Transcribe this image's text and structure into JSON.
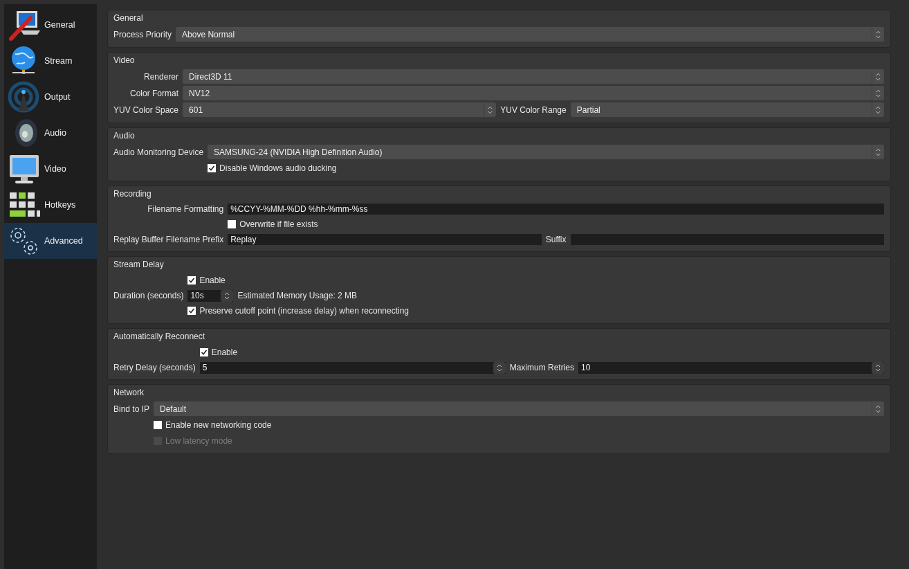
{
  "sidebar": {
    "items": [
      {
        "label": "General",
        "selected": false
      },
      {
        "label": "Stream",
        "selected": false
      },
      {
        "label": "Output",
        "selected": false
      },
      {
        "label": "Audio",
        "selected": false
      },
      {
        "label": "Video",
        "selected": false
      },
      {
        "label": "Hotkeys",
        "selected": false
      },
      {
        "label": "Advanced",
        "selected": true
      }
    ]
  },
  "sections": [
    {
      "title": "General",
      "rows": [
        {
          "label": "Process Priority",
          "controls": [
            {
              "kind": "select",
              "value": "Above Normal"
            }
          ]
        }
      ]
    },
    {
      "title": "Video",
      "rows": [
        {
          "label": "Renderer",
          "controls": [
            {
              "kind": "select",
              "value": "Direct3D 11"
            }
          ]
        },
        {
          "label": "Color Format",
          "controls": [
            {
              "kind": "select",
              "value": "NV12"
            }
          ]
        },
        {
          "label": "YUV Color Space",
          "controls": [
            {
              "kind": "select",
              "value": "601"
            },
            {
              "kind": "label",
              "text": "YUV Color Range"
            },
            {
              "kind": "select",
              "value": "Partial"
            }
          ]
        }
      ]
    },
    {
      "title": "Audio",
      "rows": [
        {
          "label": "Audio Monitoring Device",
          "controls": [
            {
              "kind": "select",
              "value": "SAMSUNG-24 (NVIDIA High Definition Audio)"
            }
          ]
        },
        {
          "controls": [
            {
              "kind": "checkbox",
              "text": "Disable Windows audio ducking",
              "checked": true,
              "disabled": false
            }
          ]
        }
      ]
    },
    {
      "title": "Recording",
      "rows": [
        {
          "label": "Filename Formatting",
          "controls": [
            {
              "kind": "text",
              "value": "%CCYY-%MM-%DD %hh-%mm-%ss"
            }
          ]
        },
        {
          "controls": [
            {
              "kind": "checkbox",
              "text": "Overwrite if file exists",
              "checked": false,
              "disabled": false
            }
          ]
        },
        {
          "label": "Replay Buffer Filename Prefix",
          "controls": [
            {
              "kind": "text",
              "value": "Replay"
            },
            {
              "kind": "label",
              "text": "Suffix"
            },
            {
              "kind": "text"
            }
          ]
        }
      ]
    },
    {
      "title": "Stream Delay",
      "rows": [
        {
          "controls": [
            {
              "kind": "checkbox",
              "text": "Enable",
              "checked": true,
              "disabled": false
            }
          ]
        },
        {
          "label": "Duration (seconds)",
          "controls": [
            {
              "kind": "spin",
              "value": "10s"
            },
            {
              "kind": "note",
              "text": "Estimated Memory Usage: 2 MB"
            }
          ]
        },
        {
          "controls": [
            {
              "kind": "checkbox",
              "text": "Preserve cutoff point (increase delay) when reconnecting",
              "checked": true,
              "disabled": false
            }
          ]
        }
      ]
    },
    {
      "title": "Automatically Reconnect",
      "rows": [
        {
          "controls": [
            {
              "kind": "checkbox",
              "text": "Enable",
              "checked": true,
              "disabled": false
            }
          ]
        },
        {
          "label": "Retry Delay (seconds)",
          "controls": [
            {
              "kind": "spin",
              "value": "5"
            },
            {
              "kind": "label",
              "text": "Maximum Retries"
            },
            {
              "kind": "spin",
              "value": "10"
            }
          ]
        }
      ]
    },
    {
      "title": "Network",
      "rows": [
        {
          "label": "Bind to IP",
          "controls": [
            {
              "kind": "select",
              "value": "Default"
            }
          ]
        },
        {
          "controls": [
            {
              "kind": "checkbox",
              "text": "Enable new networking code",
              "checked": false,
              "disabled": false
            }
          ]
        },
        {
          "controls": [
            {
              "kind": "checkbox",
              "text": "Low latency mode",
              "checked": false,
              "disabled": true
            }
          ]
        }
      ]
    }
  ]
}
